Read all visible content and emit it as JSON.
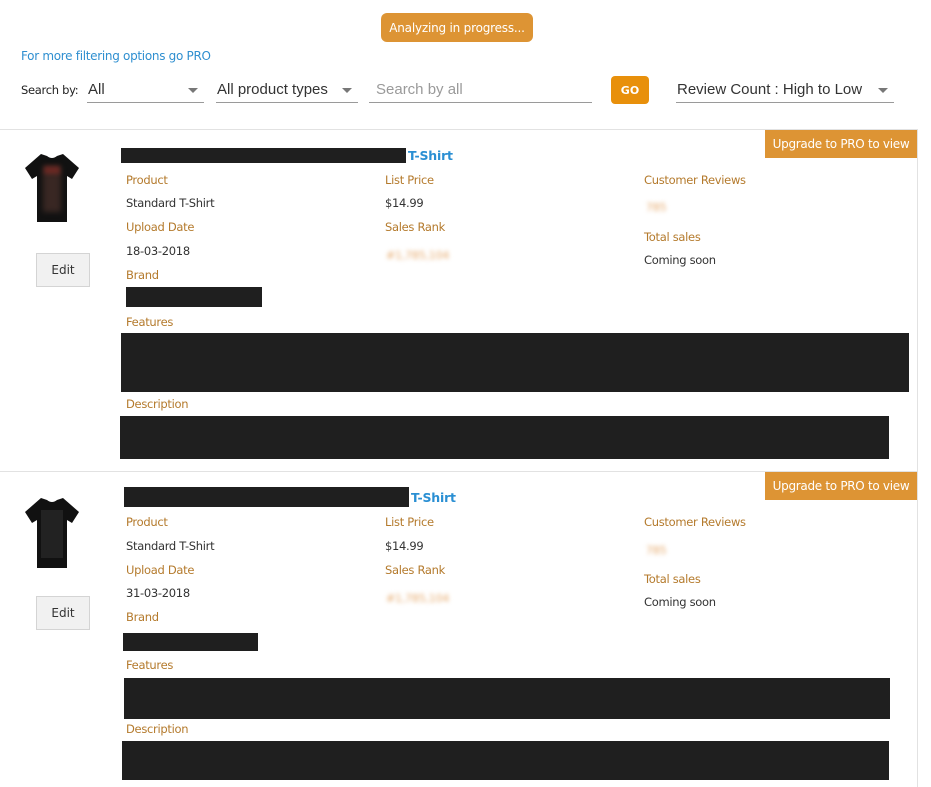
{
  "header": {
    "status_badge": "Analyzing in progress...",
    "pro_link": "For more filtering options go PRO",
    "search_label": "Search by:",
    "search_by_select": "All",
    "product_type_select": "All product types",
    "search_input": {
      "value": "",
      "placeholder": "Search by all"
    },
    "go_button": "GO",
    "sort_select": "Review Count : High to Low"
  },
  "labels": {
    "product": "Product",
    "upload_date": "Upload Date",
    "brand": "Brand",
    "list_price": "List Price",
    "sales_rank": "Sales Rank",
    "customer_reviews": "Customer Reviews",
    "total_sales": "Total sales",
    "features": "Features",
    "description": "Description",
    "edit": "Edit",
    "upgrade": "Upgrade to PRO to view"
  },
  "products": [
    {
      "title_suffix": "T-Shirt",
      "product": "Standard T-Shirt",
      "upload_date": "18-03-2018",
      "list_price": "$14.99",
      "sales_rank": "#1,785,104",
      "customer_reviews": "785",
      "total_sales": "Coming soon"
    },
    {
      "title_suffix": "T-Shirt",
      "product": "Standard T-Shirt",
      "upload_date": "31-03-2018",
      "list_price": "$14.99",
      "sales_rank": "#1,785,104",
      "customer_reviews": "785",
      "total_sales": "Coming soon"
    }
  ],
  "colors": {
    "accent_orange": "#dd9434",
    "go_orange": "#e8900b",
    "link_blue": "#2f8fd0",
    "label_brown": "#b47a2c"
  }
}
